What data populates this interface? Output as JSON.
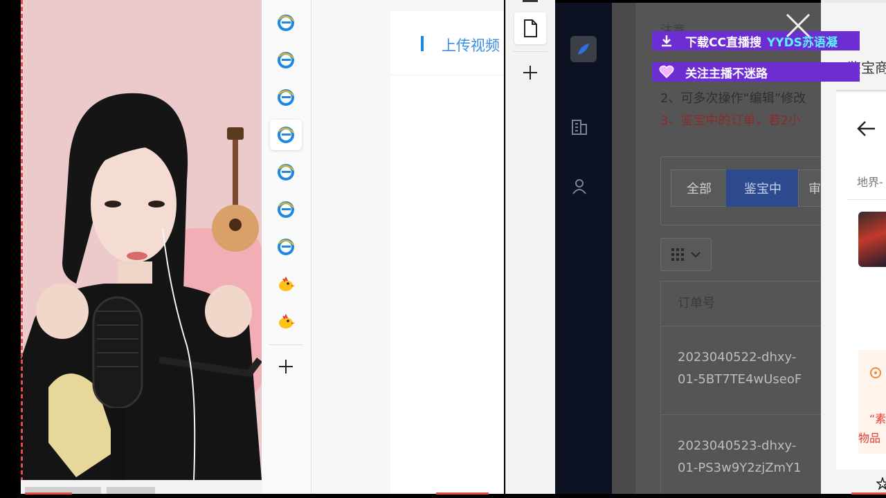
{
  "stream_overlay": {
    "banner_download": {
      "text": "下载CC直播搜",
      "highlight": "YYDS苏语凝"
    },
    "banner_follow": {
      "text": "关注主播不迷路"
    },
    "close_symbol": "✕"
  },
  "upload": {
    "title": "上传视频"
  },
  "admin": {
    "notice_title": "注意",
    "notice_line2": "2、可多次操作“编辑”修改",
    "notice_line3": "3、鉴宝中的订单，若2小",
    "tabs": [
      "全部",
      "鉴宝中",
      "审"
    ],
    "active_tab": "鉴宝中",
    "table_header": "订单号",
    "orders": [
      {
        "line1": "2023040522-dhxy-",
        "line2": "01-5BT7TE4wUseoF"
      },
      {
        "line1": "2023040523-dhxy-",
        "line2": "01-PS3w9Y2zjZmY1"
      }
    ]
  },
  "phone": {
    "header_text": "鉴宝商",
    "sub_text": "地界-",
    "warn_line1": "“素",
    "warn_line2": "物品"
  },
  "colors": {
    "accent_blue": "#1e88e5",
    "banner_purple": "#6c2ed3",
    "banner_highlight": "#5cf0ff",
    "active_tab": "#2e4a8f",
    "warning_red": "#e53935"
  }
}
